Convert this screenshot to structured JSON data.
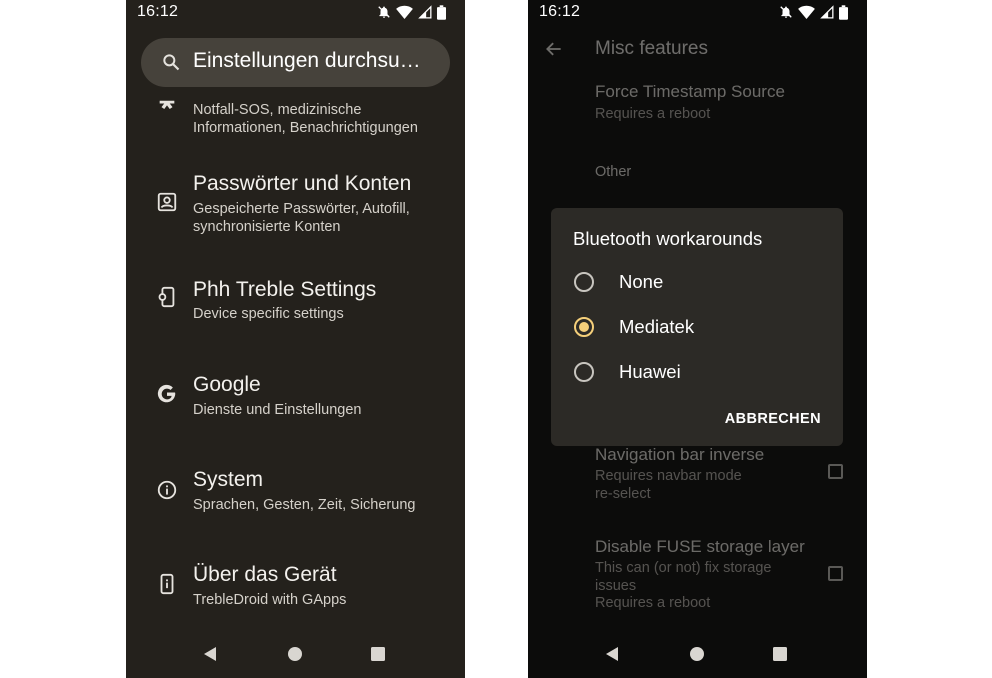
{
  "status_bar": {
    "time": "16:12"
  },
  "left": {
    "search_placeholder": "Einstellungen durchsu…",
    "items": [
      {
        "icon": "emergency-icon",
        "title": "",
        "subtitle": [
          "Notfall-SOS, medizinische",
          "Informationen, Benachrichtigungen"
        ]
      },
      {
        "icon": "account-box-icon",
        "title": "Passwörter und Konten",
        "subtitle": [
          "Gespeicherte Passwörter, Autofill,",
          "synchronisierte Konten"
        ]
      },
      {
        "icon": "phone-settings-icon",
        "title": "Phh Treble Settings",
        "subtitle": [
          "Device specific settings"
        ]
      },
      {
        "icon": "google-icon",
        "title": "Google",
        "subtitle": [
          "Dienste und Einstellungen"
        ]
      },
      {
        "icon": "info-icon",
        "title": "System",
        "subtitle": [
          "Sprachen, Gesten, Zeit, Sicherung"
        ]
      },
      {
        "icon": "device-info-icon",
        "title": "Über das Gerät",
        "subtitle": [
          "TrebleDroid with GApps"
        ]
      }
    ]
  },
  "right": {
    "title": "Misc features",
    "prefs": [
      {
        "title": "Force Timestamp Source",
        "subtitle": [
          "Requires a reboot"
        ],
        "checkbox": false
      },
      {
        "title": "Navigation bar inverse",
        "subtitle": [
          "Requires navbar mode",
          "re-select"
        ],
        "checkbox": true,
        "checked": false
      },
      {
        "title": "Disable FUSE storage layer",
        "subtitle": [
          "This can (or not) fix storage",
          "issues",
          "Requires a reboot"
        ],
        "checkbox": true,
        "checked": false
      }
    ],
    "category_label": "Other",
    "dialog": {
      "title": "Bluetooth workarounds",
      "options": [
        "None",
        "Mediatek",
        "Huawei"
      ],
      "selected": "Mediatek",
      "cancel_label": "ABBRECHEN",
      "accent_color": "#f5cf7a"
    }
  }
}
